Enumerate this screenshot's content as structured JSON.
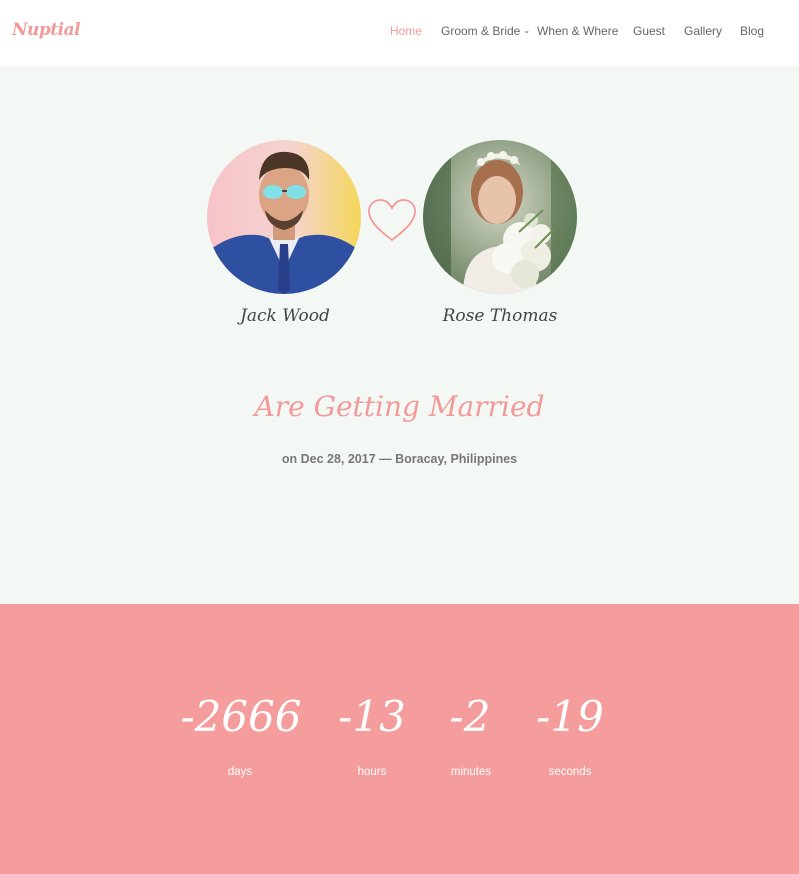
{
  "brand": {
    "logo": "Nuptial",
    "accent": "#f29a99"
  },
  "nav": {
    "items": [
      {
        "label": "Home",
        "active": true
      },
      {
        "label": "Groom & Bride",
        "has_dropdown": true
      },
      {
        "label": "When & Where"
      },
      {
        "label": "Guest"
      },
      {
        "label": "Gallery"
      },
      {
        "label": "Blog"
      }
    ]
  },
  "hero": {
    "groom_name": "Jack Wood",
    "bride_name": "Rose Thomas",
    "headline": "Are Getting Married",
    "date_line": "on Dec 28, 2017 — Boracay, Philippines",
    "background": "#f4f8f5"
  },
  "countdown": {
    "background": "#f49d9c",
    "days": {
      "value": "-2666",
      "label": "days"
    },
    "hours": {
      "value": "-13",
      "label": "hours"
    },
    "minutes": {
      "value": "-2",
      "label": "minutes"
    },
    "seconds": {
      "value": "-19",
      "label": "seconds"
    }
  }
}
